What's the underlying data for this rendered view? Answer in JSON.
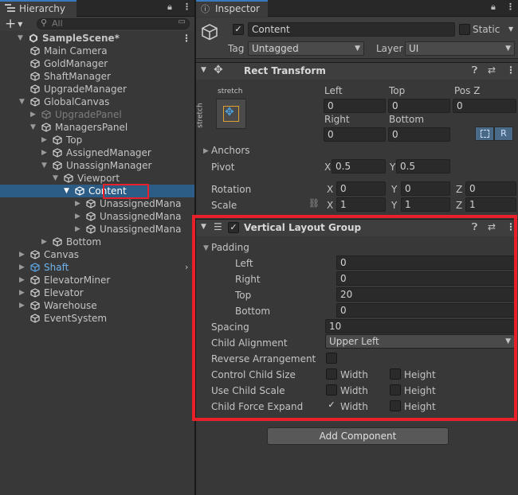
{
  "hierarchy": {
    "tab_label": "Hierarchy",
    "add_label": "+",
    "search_placeholder": "All",
    "rows": [
      {
        "label": "SampleScene*",
        "depth": 0,
        "fold": "open",
        "icon": "unity",
        "bold": true,
        "menu": true
      },
      {
        "label": "Main Camera",
        "depth": 1,
        "fold": "none",
        "icon": "cube"
      },
      {
        "label": "GoldManager",
        "depth": 1,
        "fold": "none",
        "icon": "cube"
      },
      {
        "label": "ShaftManager",
        "depth": 1,
        "fold": "none",
        "icon": "cube"
      },
      {
        "label": "UpgradeManager",
        "depth": 1,
        "fold": "none",
        "icon": "cube"
      },
      {
        "label": "GlobalCanvas",
        "depth": 1,
        "fold": "open",
        "icon": "cube"
      },
      {
        "label": "UpgradePanel",
        "depth": 2,
        "fold": "closed",
        "icon": "cube",
        "dim": true
      },
      {
        "label": "ManagersPanel",
        "depth": 2,
        "fold": "open",
        "icon": "cube"
      },
      {
        "label": "Top",
        "depth": 3,
        "fold": "closed",
        "icon": "cube"
      },
      {
        "label": "AssignedManager",
        "depth": 3,
        "fold": "closed",
        "icon": "cube"
      },
      {
        "label": "UnassignManager",
        "depth": 3,
        "fold": "open",
        "icon": "cube"
      },
      {
        "label": "Viewport",
        "depth": 4,
        "fold": "open",
        "icon": "cube"
      },
      {
        "label": "Content",
        "depth": 5,
        "fold": "open",
        "icon": "cube",
        "selected": true
      },
      {
        "label": "UnassignedMana",
        "depth": 6,
        "fold": "closed",
        "icon": "cube"
      },
      {
        "label": "UnassignedMana",
        "depth": 6,
        "fold": "closed",
        "icon": "cube"
      },
      {
        "label": "UnassignedMana",
        "depth": 6,
        "fold": "closed",
        "icon": "cube"
      },
      {
        "label": "Bottom",
        "depth": 3,
        "fold": "closed",
        "icon": "cube"
      },
      {
        "label": "Canvas",
        "depth": 1,
        "fold": "closed",
        "icon": "cube"
      },
      {
        "label": "Shaft",
        "depth": 1,
        "fold": "closed",
        "icon": "cube-blue",
        "blue": true,
        "arrow": true
      },
      {
        "label": "ElevatorMiner",
        "depth": 1,
        "fold": "closed",
        "icon": "cube"
      },
      {
        "label": "Elevator",
        "depth": 1,
        "fold": "closed",
        "icon": "cube"
      },
      {
        "label": "Warehouse",
        "depth": 1,
        "fold": "closed",
        "icon": "cube"
      },
      {
        "label": "EventSystem",
        "depth": 1,
        "fold": "none",
        "icon": "cube"
      }
    ]
  },
  "inspector": {
    "tab_label": "Inspector",
    "object_name": "Content",
    "static_label": "Static",
    "tag_label": "Tag",
    "tag_value": "Untagged",
    "layer_label": "Layer",
    "layer_value": "UI",
    "rect_transform": {
      "title": "Rect Transform",
      "anchor_top": "stretch",
      "anchor_side": "stretch",
      "left_label": "Left",
      "left": "0",
      "top_label": "Top",
      "top": "0",
      "posz_label": "Pos Z",
      "posz": "0",
      "right_label": "Right",
      "right": "0",
      "bottom_label": "Bottom",
      "bottom": "0",
      "r_button": "R",
      "anchors_label": "Anchors",
      "pivot_label": "Pivot",
      "pivot_x": "0.5",
      "pivot_y": "0.5",
      "rotation_label": "Rotation",
      "rot_x": "0",
      "rot_y": "0",
      "rot_z": "0",
      "scale_label": "Scale",
      "scale_x": "1",
      "scale_y": "1",
      "scale_z": "1",
      "x": "X",
      "y": "Y",
      "z": "Z"
    },
    "vlg": {
      "title": "Vertical Layout Group",
      "padding_label": "Padding",
      "pad_left_label": "Left",
      "pad_left": "0",
      "pad_right_label": "Right",
      "pad_right": "0",
      "pad_top_label": "Top",
      "pad_top": "20",
      "pad_bottom_label": "Bottom",
      "pad_bottom": "0",
      "spacing_label": "Spacing",
      "spacing": "10",
      "alignment_label": "Child Alignment",
      "alignment": "Upper Left",
      "reverse_label": "Reverse Arrangement",
      "control_label": "Control Child Size",
      "scale_label": "Use Child Scale",
      "expand_label": "Child Force Expand",
      "width": "Width",
      "height": "Height",
      "control_width": false,
      "control_height": false,
      "scale_width": false,
      "scale_height": false,
      "expand_width": true,
      "expand_height": false
    },
    "add_component": "Add Component"
  },
  "highlight_color": "#e8202a",
  "accent_blue": "#3a79bb"
}
